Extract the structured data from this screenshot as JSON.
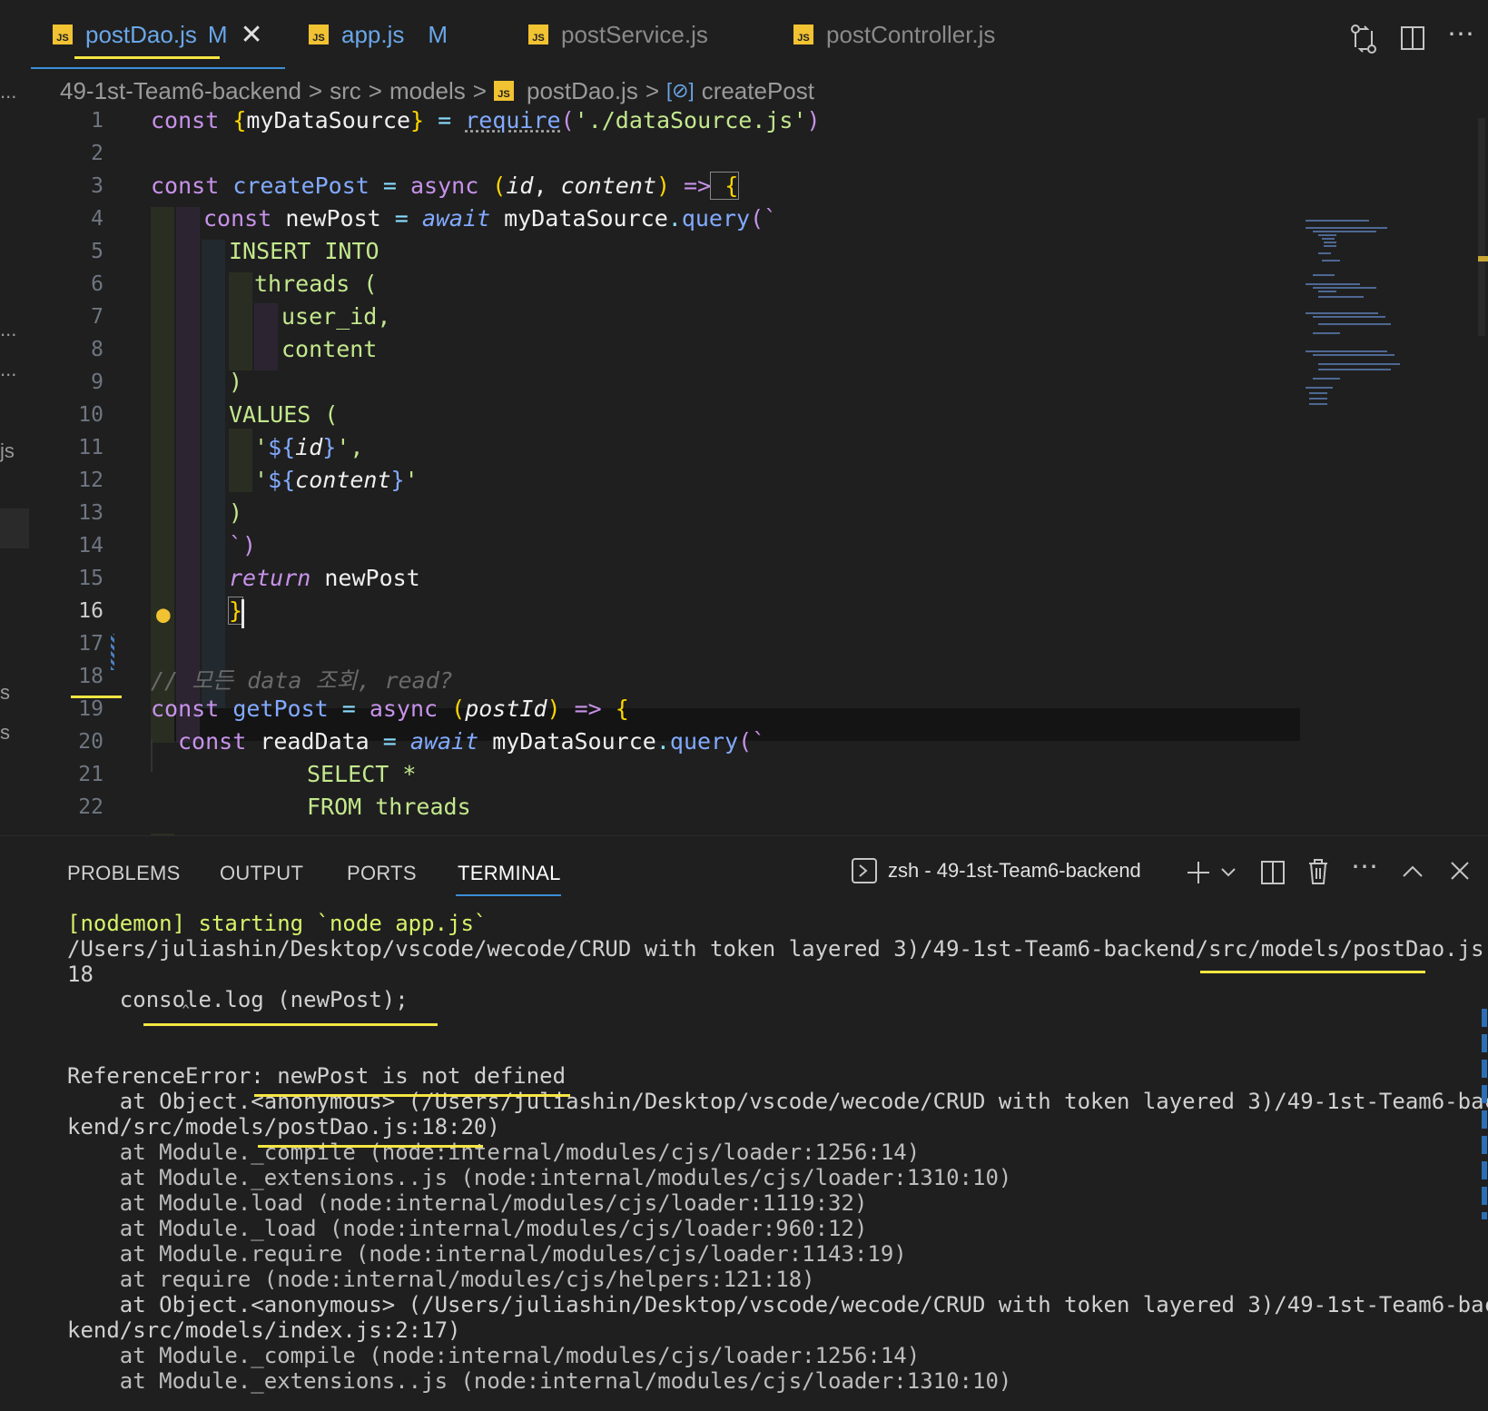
{
  "tabs": [
    {
      "label": "postDao.js",
      "badge": "JS",
      "status": "M",
      "active": true
    },
    {
      "label": "app.js",
      "badge": "JS",
      "status": "M",
      "active": false
    },
    {
      "label": "postService.js",
      "badge": "JS",
      "status": "",
      "active": false
    },
    {
      "label": "postController.js",
      "badge": "JS",
      "status": "",
      "active": false
    }
  ],
  "tab_close_glyph": "✕",
  "toolbar_icons": [
    "compare-changes-icon",
    "split-editor-icon",
    "more-actions-icon"
  ],
  "breadcrumb": {
    "items": [
      "49-1st-Team6-backend",
      "src",
      "models",
      "postDao.js",
      "createPost"
    ],
    "separator": ">"
  },
  "editor": {
    "current_line": 16,
    "line_numbers": [
      "1",
      "2",
      "3",
      "4",
      "5",
      "6",
      "7",
      "8",
      "9",
      "10",
      "11",
      "12",
      "13",
      "14",
      "15",
      "16",
      "17",
      "18",
      "19",
      "20",
      "21",
      "22"
    ],
    "lines": {
      "l1": {
        "a": "const ",
        "b": "{",
        "c": "myDataSource",
        "d": "}",
        "e": " = ",
        "f": "require",
        "g": "(",
        "h": "'./dataSource.js'",
        "i": ")"
      },
      "l3": {
        "a": "const ",
        "b": "createPost",
        "c": " = ",
        "d": "async ",
        "e": "(",
        "f": "id",
        "g": ", ",
        "h": "content",
        "i": ") ",
        "j": "=>",
        "k": " {"
      },
      "l4": {
        "a": "const ",
        "b": "newPost",
        "c": " = ",
        "d": "await ",
        "e": "myDataSource",
        "f": ".",
        "g": "query",
        "h": "(`"
      },
      "l5": "INSERT INTO",
      "l6": "threads (",
      "l7": "user_id,",
      "l8": "content",
      "l9": ")",
      "l10": "VALUES (",
      "l11": {
        "a": "'",
        "b": "${",
        "c": "id",
        "d": "}",
        "e": "',"
      },
      "l12": {
        "a": "'",
        "b": "${",
        "c": "content",
        "d": "}",
        "e": "'"
      },
      "l13": ")",
      "l14": "`)",
      "l15": {
        "a": "return ",
        "b": "newPost"
      },
      "l16": "}",
      "l18": "// 모든 data 조회, read?",
      "l19": {
        "a": "const ",
        "b": "getPost",
        "c": " = ",
        "d": "async ",
        "e": "(",
        "f": "postId",
        "g": ") ",
        "h": "=>",
        "i": " {"
      },
      "l20": {
        "a": "const ",
        "b": "readData",
        "c": " = ",
        "d": "await ",
        "e": "myDataSource",
        "f": ".",
        "g": "query",
        "h": "(`"
      },
      "l21": "SELECT *",
      "l22": "FROM threads"
    }
  },
  "panel": {
    "tabs": [
      "PROBLEMS",
      "OUTPUT",
      "PORTS",
      "TERMINAL"
    ],
    "active_tab": "TERMINAL",
    "terminal_name": "zsh - 49-1st-Team6-backend",
    "terminal_icons": [
      "add-terminal-icon",
      "chevron-down-icon",
      "split-terminal-icon",
      "trash-icon",
      "more-actions-icon",
      "maximize-panel-icon",
      "close-panel-icon"
    ],
    "output": [
      "[nodemon] starting `node app.js`",
      "/Users/juliashin/Desktop/vscode/wecode/CRUD with token layered 3)/49-1st-Team6-backend/src/models/postDao.js:",
      "18",
      "    console.log (newPost);",
      "               ^",
      "",
      "ReferenceError: newPost is not defined",
      "    at Object.<anonymous> (/Users/juliashin/Desktop/vscode/wecode/CRUD with token layered 3)/49-1st-Team6-bac",
      "kend/src/models/postDao.js:18:20)",
      "    at Module._compile (node:internal/modules/cjs/loader:1256:14)",
      "    at Module._extensions..js (node:internal/modules/cjs/loader:1310:10)",
      "    at Module.load (node:internal/modules/cjs/loader:1119:32)",
      "    at Module._load (node:internal/modules/cjs/loader:960:12)",
      "    at Module.require (node:internal/modules/cjs/loader:1143:19)",
      "    at require (node:internal/modules/cjs/helpers:121:18)",
      "    at Object.<anonymous> (/Users/juliashin/Desktop/vscode/wecode/CRUD with token layered 3)/49-1st-Team6-bac",
      "kend/src/models/index.js:2:17)",
      "    at Module._compile (node:internal/modules/cjs/loader:1256:14)",
      "    at Module._extensions..js (node:internal/modules/cjs/loader:1310:10)"
    ]
  },
  "sidebar_fragments": [
    "...",
    "...",
    "...",
    "js",
    "s",
    "s",
    "...",
    "..."
  ],
  "colors": {
    "accent_blue": "#3b8ed8",
    "annotation_yellow": "#f5e642",
    "js_badge": "#f1c232",
    "background": "#1f1f1f"
  }
}
